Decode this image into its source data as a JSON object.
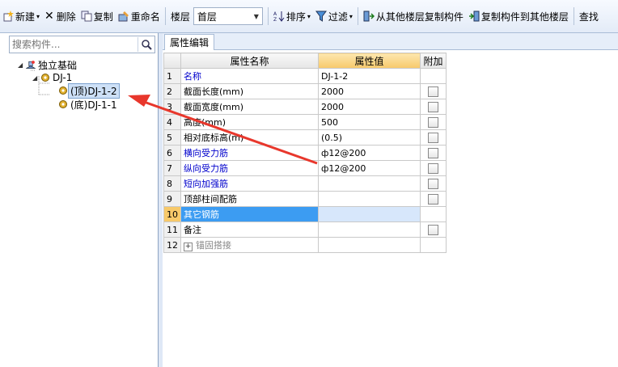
{
  "toolbar": {
    "new_label": "新建",
    "delete_label": "删除",
    "copy_label": "复制",
    "rename_label": "重命名",
    "floor_label": "楼层",
    "floor_value": "首层",
    "sort_label": "排序",
    "filter_label": "过滤",
    "copy_from_floor_label": "从其他楼层复制构件",
    "copy_to_floor_label": "复制构件到其他楼层",
    "find_label": "查找"
  },
  "search": {
    "placeholder": "搜索构件..."
  },
  "tree": {
    "root": "独立基础",
    "group": "DJ-1",
    "children": [
      "(顶)DJ-1-2",
      "(底)DJ-1-1"
    ]
  },
  "tab": {
    "label": "属性编辑"
  },
  "table": {
    "headers": [
      "属性名称",
      "属性值",
      "附加"
    ],
    "rows": [
      {
        "num": "1",
        "name": "名称",
        "value": "DJ-1-2"
      },
      {
        "num": "2",
        "name": "截面长度(mm)",
        "value": "2000"
      },
      {
        "num": "3",
        "name": "截面宽度(mm)",
        "value": "2000"
      },
      {
        "num": "4",
        "name": "高度(mm)",
        "value": "500"
      },
      {
        "num": "5",
        "name": "相对底标高(m)",
        "value": "(0.5)"
      },
      {
        "num": "6",
        "name": "横向受力筋",
        "value": "ф12@200"
      },
      {
        "num": "7",
        "name": "纵向受力筋",
        "value": "ф12@200"
      },
      {
        "num": "8",
        "name": "短向加强筋",
        "value": ""
      },
      {
        "num": "9",
        "name": "顶部柱间配筋",
        "value": ""
      },
      {
        "num": "10",
        "name": "其它钢筋",
        "value": ""
      },
      {
        "num": "11",
        "name": "备注",
        "value": ""
      },
      {
        "num": "12",
        "name": "锚固搭接",
        "value": ""
      }
    ]
  }
}
